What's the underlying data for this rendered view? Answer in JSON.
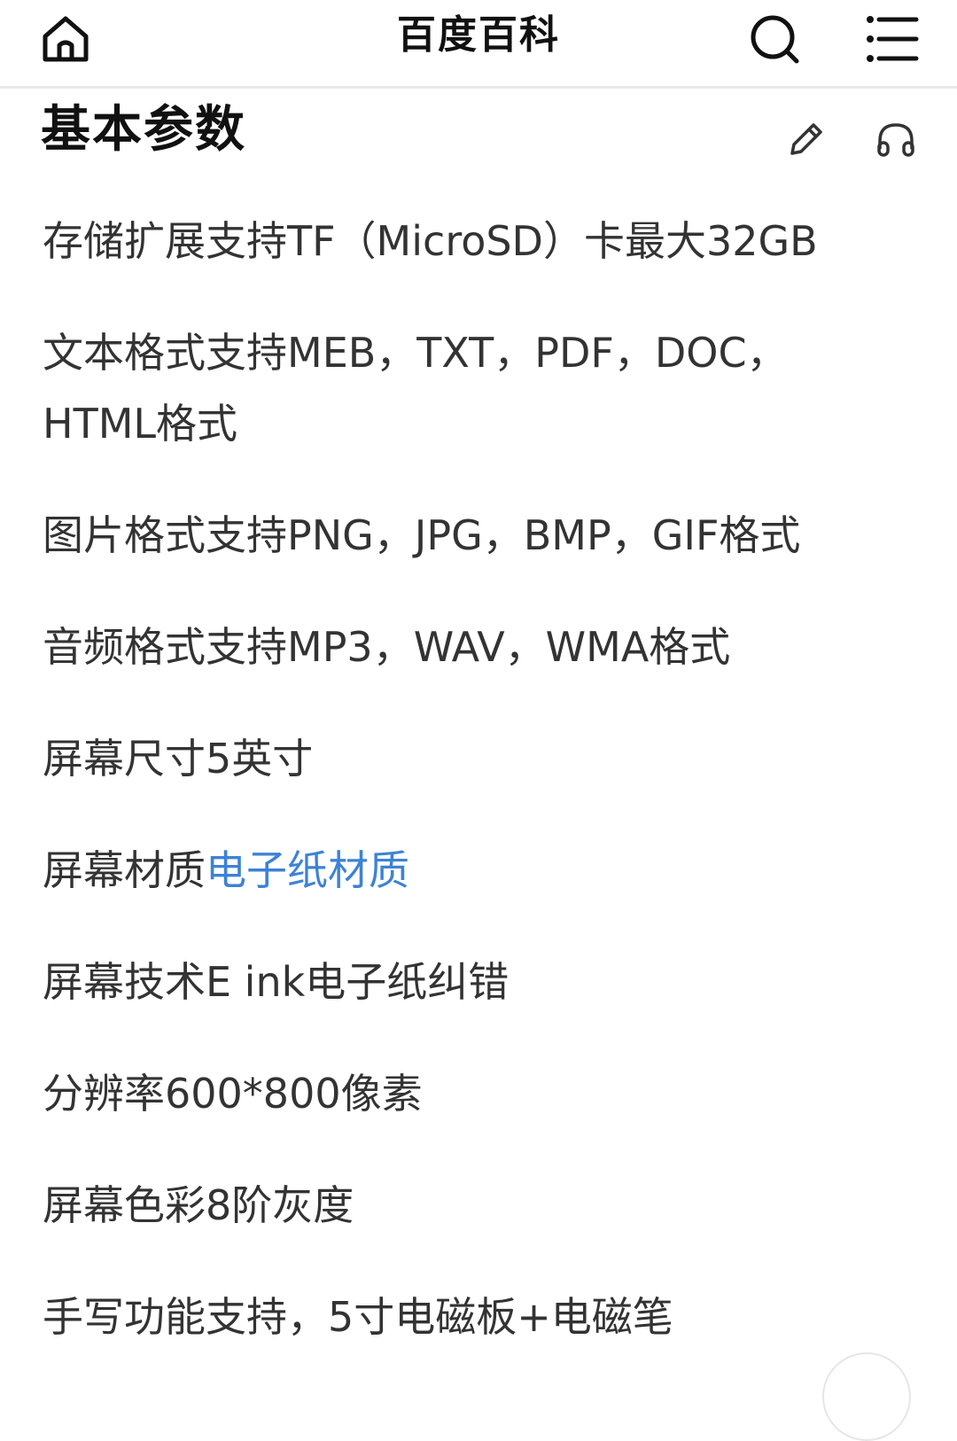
{
  "header": {
    "title": "百度百科",
    "home_icon": "home-icon",
    "search_icon": "search-icon",
    "menu_icon": "menu-icon"
  },
  "section": {
    "title": "基本参数",
    "edit_icon": "pencil-icon",
    "listen_icon": "headphones-icon"
  },
  "params": [
    {
      "label": "存储扩展",
      "value": "支持TF（MicroSD）卡最大32GB"
    },
    {
      "label": "文本格式",
      "value": "支持MEB，TXT，PDF，DOC，HTML格式"
    },
    {
      "label": "图片格式",
      "value": "支持PNG，JPG，BMP，GIF格式"
    },
    {
      "label": "音频格式",
      "value": "支持MP3，WAV，WMA格式"
    },
    {
      "label": "屏幕尺寸",
      "value": "5英寸"
    },
    {
      "label": "屏幕材质",
      "value": "电子纸材质"
    },
    {
      "label": "屏幕技术",
      "value": "E ink电子纸纠错"
    },
    {
      "label": "分辨率",
      "value": "600*800像素"
    },
    {
      "label": "屏幕色彩",
      "value": "8阶灰度"
    },
    {
      "label": "手写功能",
      "value": "支持，5寸电磁板+电磁笔"
    }
  ],
  "colors": {
    "link": "#3d82d6",
    "text": "#333333",
    "title": "#111111",
    "divider": "#e9e9e9"
  }
}
